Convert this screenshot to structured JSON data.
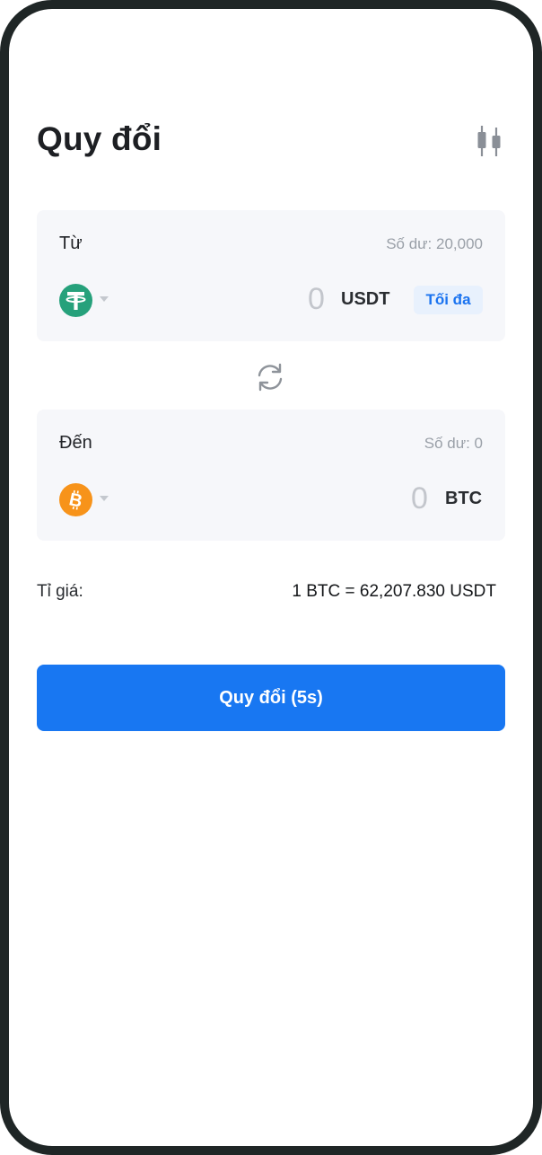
{
  "header": {
    "title": "Quy đổi",
    "chart_icon": "candlestick-chart-icon"
  },
  "from": {
    "label": "Từ",
    "balance": "Số dư: 20,000",
    "coin_icon": "tether-icon",
    "amount": "0",
    "currency": "USDT",
    "max_label": "Tối đa"
  },
  "to": {
    "label": "Đến",
    "balance": "Số dư: 0",
    "coin_icon": "bitcoin-icon",
    "amount": "0",
    "currency": "BTC"
  },
  "swap_icon": "swap-refresh-icon",
  "rate": {
    "label": "Tỉ giá:",
    "value": "1 BTC = 62,207.830 USDT"
  },
  "convert_button": {
    "label": "Quy đổi (5s)"
  },
  "colors": {
    "accent": "#1877f2",
    "tether": "#26a17b",
    "bitcoin": "#f7931a",
    "card_bg": "#f6f7fa"
  }
}
